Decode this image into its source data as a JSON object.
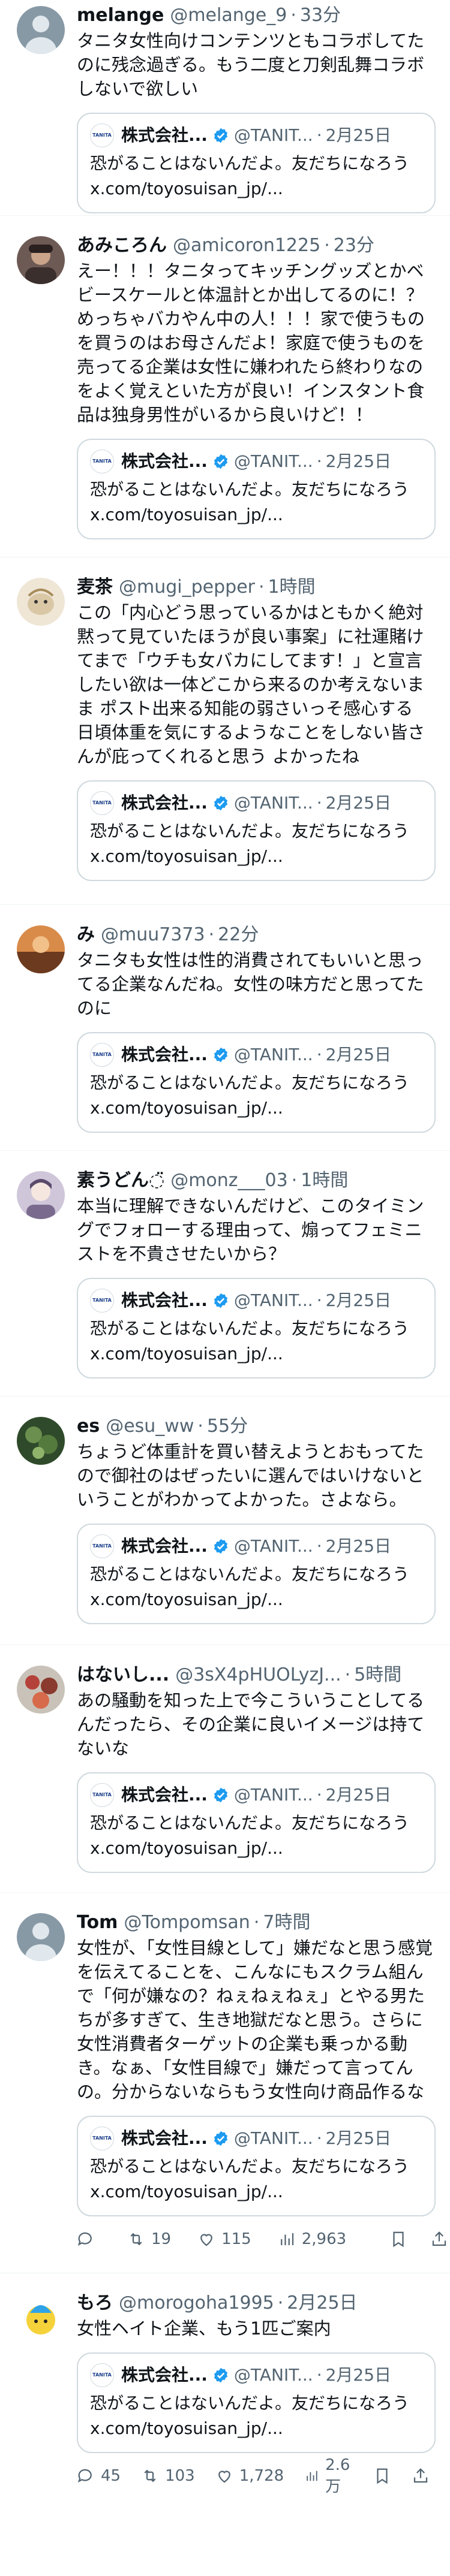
{
  "quoted": {
    "logo_text": "TANITA",
    "name": "株式会社...",
    "handle": "@TANIT...",
    "time": "2月25日",
    "text_line1": "恐がることはないんだよ。友だちになろう",
    "text_line2": "x.com/toyosuisan_jp/..."
  },
  "replies": [
    {
      "name": "melange",
      "handle": "@melange_9",
      "time": "33分",
      "text": "タニタ女性向けコンテンツともコラボしてたのに残念過ぎる。もう二度と刀剣乱舞コラボしないで欲しい",
      "avatar_color": "#8899a6"
    },
    {
      "name": "あみころん",
      "handle": "@amicoron1225",
      "time": "23分",
      "text": "えー！！！タニタってキッチングッズとかベビースケールと体温計とか出してるのに！？めっちゃバカやん中の人！！！家で使うものを買うのはお母さんだよ！家庭で使うものを売ってる企業は女性に嫌われたら終わりなのをよく覚えといた方が良い！インスタント食品は独身男性がいるから良いけど！！",
      "avatar_color": "#6e5a55"
    },
    {
      "name": "麦茶",
      "handle": "@mugi_pepper",
      "time": "1時間",
      "text": "この「内心どう思っているかはともかく絶対黙って見ていたほうが良い事案」に社運賭けてまで「ウチも女バカにしてます！」と宣言したい欲は一体どこから来るのか考えないまま ポスト出来る知能の弱さいっそ感心する 日頃体重を気にするようなことをしない皆さんが庇ってくれると思う よかったね",
      "avatar_color": "#d9c7a6"
    },
    {
      "name": "み",
      "handle": "@muu7373",
      "time": "22分",
      "text": "タニタも女性は性的消費されてもいいと思ってる企業なんだね。女性の味方だと思ってたのに",
      "avatar_color": "#b35b2a"
    },
    {
      "name": "素うどん◌̈",
      "handle": "@monz___03",
      "time": "1時間",
      "text": "本当に理解できないんだけど、このタイミングでフォローする理由って、煽ってフェミニストを不貴させたいから？",
      "avatar_color": "#a79bb5"
    },
    {
      "name": "es",
      "handle": "@esu_ww",
      "time": "55分",
      "text": "ちょうど体重計を買い替えようとおもってたので御社のはぜったいに選んではいけないということがわかってよかった。さよなら。",
      "avatar_color": "#4a6b3a"
    },
    {
      "name": "はないし...",
      "handle": "@3sX4pHUOLyzJ...",
      "time": "5時間",
      "text": "あの騒動を知った上で今こういうことしてるんだったら、その企業に良いイメージは持てないな",
      "avatar_color": "#9b4a3a"
    },
    {
      "name": "Tom",
      "handle": "@Tompomsan",
      "time": "7時間",
      "text": "女性が、「女性目線として」嫌だなと思う感覚を伝えてることを、こんなにもスクラム組んで「何が嫌なの？ねぇねぇねぇ」とやる男たちが多すぎて、生き地獄だなと思う。さらに女性消費者ターゲットの企業も乗っかる動き。なぁ、「女性目線で」嫌だって言ってんの。分からないならもう女性向け商品作るな",
      "avatar_color": "#8899a6",
      "stats": {
        "replies": "",
        "reposts": "19",
        "likes": "115",
        "views": "2,963"
      }
    },
    {
      "name": "もろ",
      "handle": "@morogoha1995",
      "time": "2月25日",
      "text": "女性ヘイト企業、もう1匹ご案内",
      "avatar_color": "#2ea3e8",
      "stats": {
        "replies": "45",
        "reposts": "103",
        "likes": "1,728",
        "views": "2.6万"
      }
    }
  ]
}
